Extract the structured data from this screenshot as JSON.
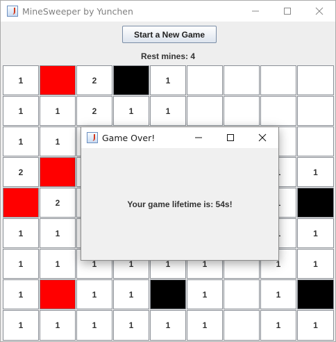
{
  "window": {
    "title": "MineSweeper by Yunchen"
  },
  "toolbar": {
    "new_game_label": "Start a New Game",
    "rest_mines": "Rest mines: 4"
  },
  "board": {
    "rows": 9,
    "cols": 9,
    "colors": {
      "flagged": "#ff0000",
      "mine": "#000000",
      "empty": "#ffffff"
    },
    "cells": [
      [
        "1",
        "red",
        "2",
        "black",
        "1",
        "",
        "",
        "",
        ""
      ],
      [
        "1",
        "1",
        "2",
        "1",
        "1",
        "",
        "",
        "",
        ""
      ],
      [
        "1",
        "1",
        "",
        "",
        "",
        "",
        "",
        "",
        ""
      ],
      [
        "2",
        "red",
        "",
        "",
        "",
        "",
        "",
        "1",
        "1"
      ],
      [
        "red",
        "2",
        "",
        "",
        "",
        "",
        "",
        "1",
        "black"
      ],
      [
        "1",
        "1",
        "",
        "",
        "",
        "",
        "",
        "1",
        "1"
      ],
      [
        "1",
        "1",
        "1",
        "1",
        "1",
        "1",
        "",
        "1",
        "1"
      ],
      [
        "1",
        "red",
        "1",
        "1",
        "black",
        "1",
        "",
        "1",
        "black"
      ],
      [
        "1",
        "1",
        "1",
        "1",
        "1",
        "1",
        "",
        "1",
        "1"
      ]
    ]
  },
  "dialog": {
    "title": "Game Over!",
    "message": "Your game lifetime is: 54s!"
  }
}
